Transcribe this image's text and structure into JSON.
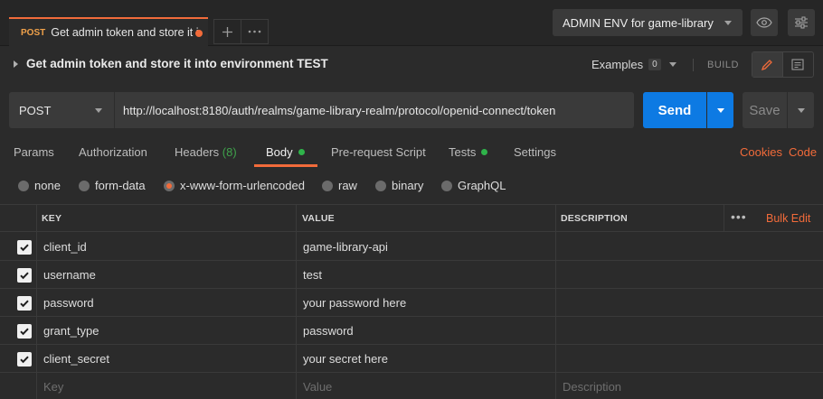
{
  "tab": {
    "method": "POST",
    "title": "Get admin token and store it i..."
  },
  "environment": {
    "selected": "ADMIN ENV for game-library"
  },
  "request": {
    "name": "Get admin token and store it into environment TEST",
    "examples_label": "Examples",
    "examples_count": "0",
    "build_label": "BUILD",
    "method": "POST",
    "url": "http://localhost:8180/auth/realms/game-library-realm/protocol/openid-connect/token",
    "send_label": "Send",
    "save_label": "Save"
  },
  "subtabs": {
    "params": "Params",
    "authorization": "Authorization",
    "headers": "Headers",
    "headers_count": "(8)",
    "body": "Body",
    "prerequest": "Pre-request Script",
    "tests": "Tests",
    "settings": "Settings",
    "cookies": "Cookies",
    "code": "Code",
    "active": "Body"
  },
  "body_types": {
    "none": "none",
    "form_data": "form-data",
    "urlencoded": "x-www-form-urlencoded",
    "raw": "raw",
    "binary": "binary",
    "graphql": "GraphQL",
    "selected": "x-www-form-urlencoded"
  },
  "table": {
    "headers": {
      "key": "KEY",
      "value": "VALUE",
      "description": "DESCRIPTION",
      "more": "•••",
      "bulk_edit": "Bulk Edit"
    },
    "rows": [
      {
        "checked": true,
        "key": "client_id",
        "value": "game-library-api",
        "description": ""
      },
      {
        "checked": true,
        "key": "username",
        "value": "test",
        "description": ""
      },
      {
        "checked": true,
        "key": "password",
        "value": "your password here",
        "description": ""
      },
      {
        "checked": true,
        "key": "grant_type",
        "value": "password",
        "description": ""
      },
      {
        "checked": true,
        "key": "client_secret",
        "value": "your secret here",
        "description": ""
      }
    ],
    "placeholders": {
      "key": "Key",
      "value": "Value",
      "description": "Description"
    }
  },
  "colors": {
    "accent": "#f26b3a",
    "send": "#0d7ae3",
    "status_dot": "#2fb34a"
  }
}
